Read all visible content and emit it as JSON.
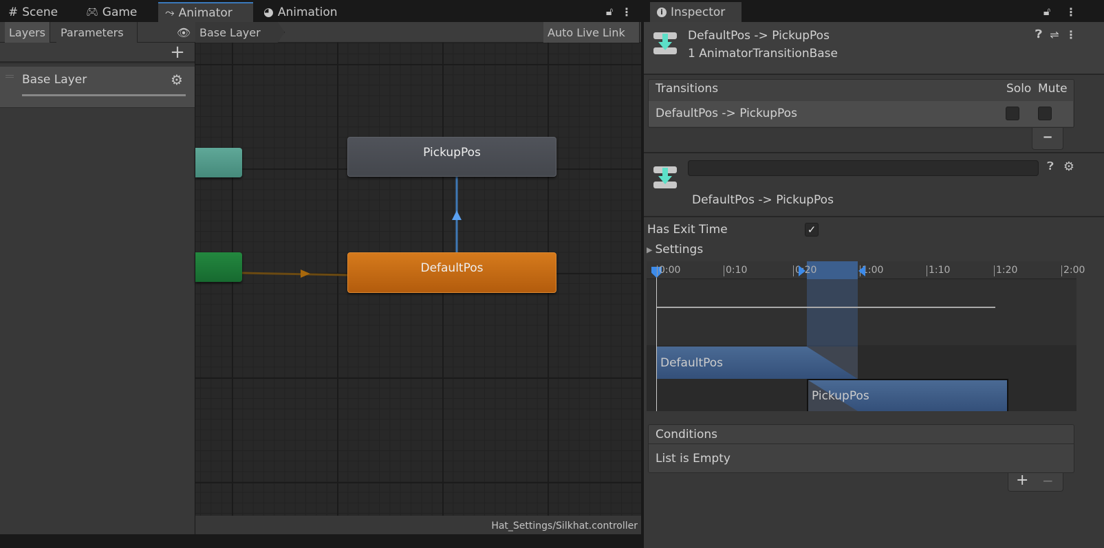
{
  "tabs": {
    "scene": "Scene",
    "game": "Game",
    "animator": "Animator",
    "animation": "Animation",
    "inspector": "Inspector"
  },
  "animator": {
    "toolbar": {
      "layers": "Layers",
      "parameters": "Parameters",
      "breadcrumb": "Base Layer",
      "auto_live_link": "Auto Live Link"
    },
    "layers": [
      {
        "name": "Base Layer",
        "weight": 1
      }
    ],
    "nodes": {
      "pickup": "PickupPos",
      "default": "DefaultPos"
    },
    "status": "Hat_Settings/Silkhat.controller"
  },
  "inspector": {
    "title": "DefaultPos -> PickupPos",
    "subtitle": "1 AnimatorTransitionBase",
    "transitions": {
      "header": "Transitions",
      "solo": "Solo",
      "mute": "Mute",
      "rows": [
        {
          "name": "DefaultPos -> PickupPos",
          "solo": false,
          "mute": false
        }
      ],
      "remove": "−"
    },
    "transition": {
      "name_value": "",
      "label": "DefaultPos -> PickupPos"
    },
    "has_exit_time": {
      "label": "Has Exit Time",
      "checked": true
    },
    "settings": "Settings",
    "timeline": {
      "ticks": [
        "0:00",
        "0:10",
        "0:20",
        "1:00",
        "1:10",
        "1:20",
        "2:00"
      ],
      "source_clip": "DefaultPos",
      "dest_clip": "PickupPos"
    },
    "conditions": {
      "header": "Conditions",
      "empty": "List is Empty",
      "add": "+",
      "remove": "−"
    }
  },
  "colors": {
    "accent": "#3a79bb",
    "default_state": "#c96e14",
    "entry": "#1c7a3a",
    "any_state": "#4f9a8a",
    "transition_arrow": "#5aa0f0",
    "teal_icon": "#5ce0c8"
  }
}
